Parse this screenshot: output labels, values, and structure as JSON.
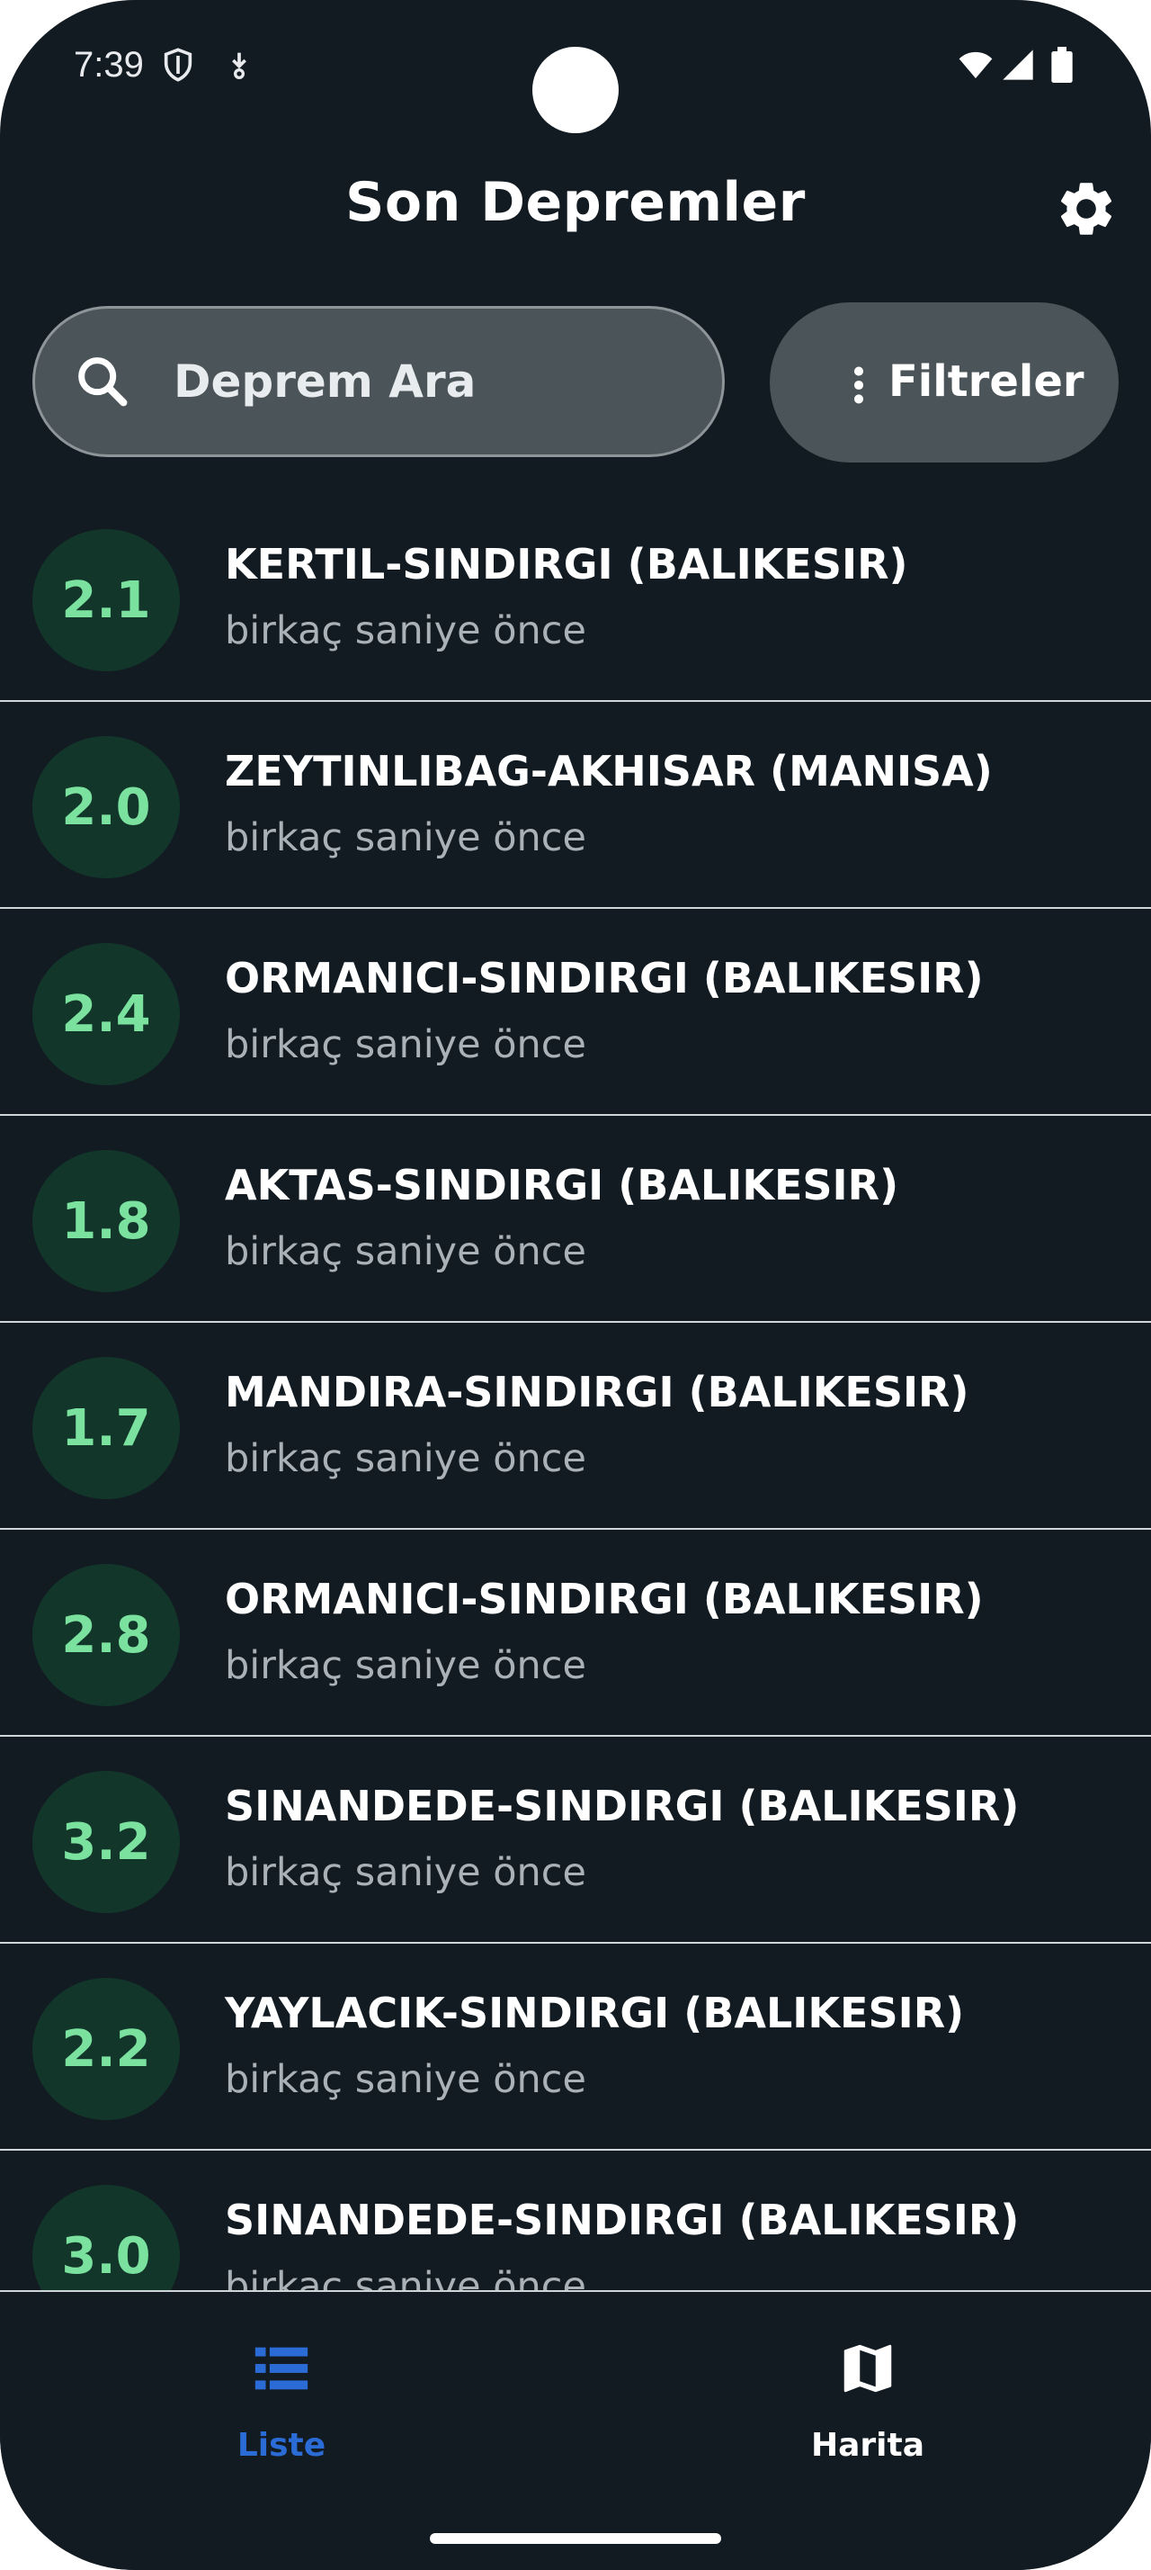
{
  "status_bar": {
    "time": "7:39",
    "left_icons": [
      "shield-icon",
      "download-icon"
    ],
    "right_icons": [
      "wifi-icon",
      "signal-icon",
      "battery-icon"
    ]
  },
  "app_bar": {
    "title": "Son Depremler",
    "settings_icon": "gear-icon"
  },
  "search": {
    "placeholder": "Deprem Ara",
    "icon": "search-icon"
  },
  "filter_button": {
    "label": "Filtreler",
    "icon": "more-vert-icon"
  },
  "earthquakes": [
    {
      "magnitude": "2.1",
      "location": "KERTIL-SINDIRGI (BALIKESIR)",
      "time": "birkaç saniye önce"
    },
    {
      "magnitude": "2.0",
      "location": "ZEYTINLIBAG-AKHISAR (MANISA)",
      "time": "birkaç saniye önce"
    },
    {
      "magnitude": "2.4",
      "location": "ORMANICI-SINDIRGI (BALIKESIR)",
      "time": "birkaç saniye önce"
    },
    {
      "magnitude": "1.8",
      "location": "AKTAS-SINDIRGI (BALIKESIR)",
      "time": "birkaç saniye önce"
    },
    {
      "magnitude": "1.7",
      "location": "MANDIRA-SINDIRGI (BALIKESIR)",
      "time": "birkaç saniye önce"
    },
    {
      "magnitude": "2.8",
      "location": "ORMANICI-SINDIRGI (BALIKESIR)",
      "time": "birkaç saniye önce"
    },
    {
      "magnitude": "3.2",
      "location": "SINANDEDE-SINDIRGI (BALIKESIR)",
      "time": "birkaç saniye önce"
    },
    {
      "magnitude": "2.2",
      "location": "YAYLACIK-SINDIRGI (BALIKESIR)",
      "time": "birkaç saniye önce"
    },
    {
      "magnitude": "3.0",
      "location": "SINANDEDE-SINDIRGI (BALIKESIR)",
      "time": "birkaç saniye önce"
    }
  ],
  "bottom_nav": {
    "items": [
      {
        "label": "Liste",
        "icon": "list-icon",
        "active": true
      },
      {
        "label": "Harita",
        "icon": "map-icon",
        "active": false
      }
    ]
  },
  "colors": {
    "background": "#121b22",
    "magnitude_badge_bg": "#12372a",
    "magnitude_text": "#7be19f",
    "active_nav": "#2b6bd6",
    "search_bg": "#4b5458"
  }
}
